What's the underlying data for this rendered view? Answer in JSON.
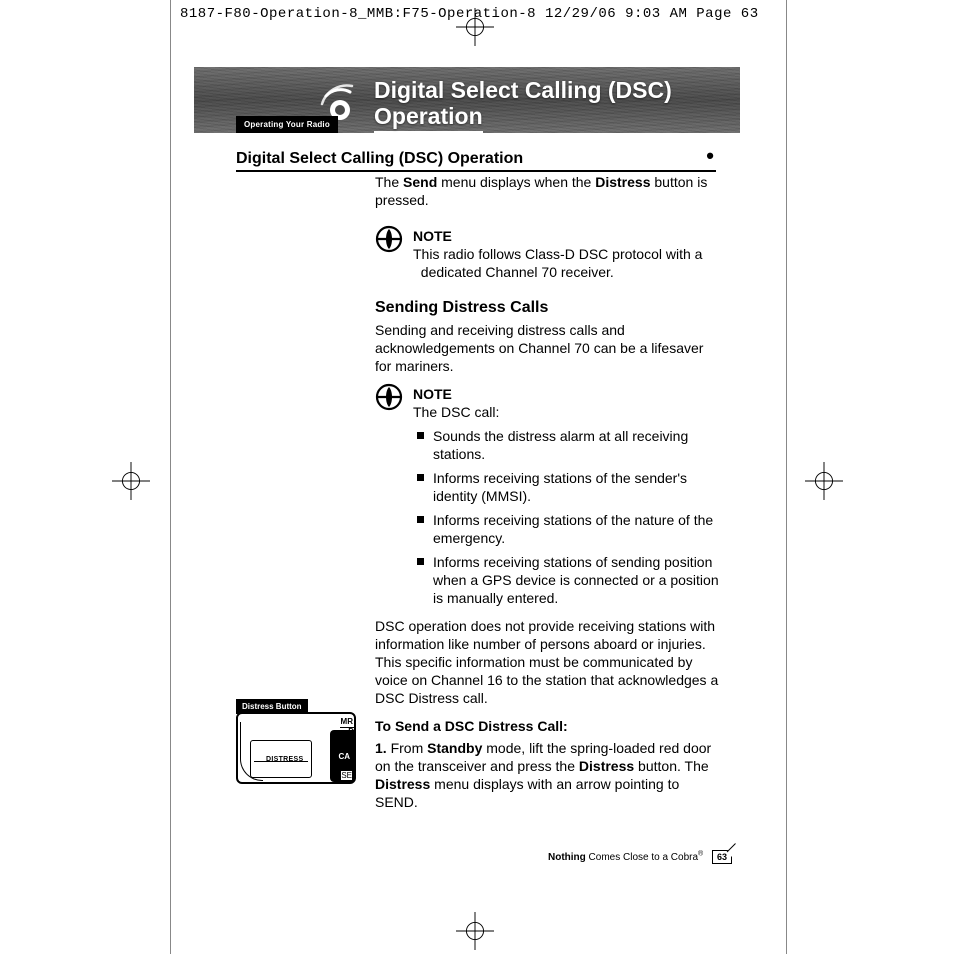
{
  "print_header": "8187-F80-Operation-8_MMB:F75-Operation-8  12/29/06  9:03 AM  Page 63",
  "banner": {
    "title_line1": "Digital Select Calling (DSC)",
    "title_line2": "Operation",
    "tab": "Operating Your Radio"
  },
  "section_heading": "Digital Select Calling (DSC) Operation",
  "intro": {
    "pre": "The ",
    "bold1": "Send",
    "mid": " menu displays when the ",
    "bold2": "Distress",
    "post": " button is pressed."
  },
  "note1": {
    "label": "NOTE",
    "line1": "This radio follows Class-D DSC protocol with a",
    "line2": "dedicated Channel 70 receiver."
  },
  "sub1": "Sending Distress Calls",
  "sub1_body": "Sending and receiving distress calls and acknowledgements on Channel 70 can be a lifesaver for mariners.",
  "note2": {
    "label": "NOTE",
    "intro": "The DSC call:"
  },
  "bullets": [
    "Sounds the distress alarm at all receiving stations.",
    "Informs receiving stations of the sender's identity (MMSI).",
    "Informs receiving stations of the nature of the emergency.",
    "Informs receiving stations of sending position when a GPS device is connected or a position is manually entered."
  ],
  "dsc_para": "DSC operation does not provide receiving stations with information like number of persons aboard or injuries. This specific information must be communicated by voice on Channel 16 to the station that acknowledges a DSC Distress call.",
  "tosend": "To Send a DSC Distress Call:",
  "step1": {
    "num": "1.",
    "a": "From ",
    "b_bold": "Standby",
    "c": " mode, lift the spring-loaded red door on the transceiver and press the ",
    "d_bold": "Distress",
    "e": " button. The ",
    "f_bold": "Distress",
    "g": " menu displays with an arrow pointing to SEND."
  },
  "figure": {
    "caption": "Distress Button",
    "label": "DISTRESS",
    "mr": "MR",
    "d": "D",
    "se": "SE",
    "ca": "CA"
  },
  "footer": {
    "bold": "Nothing",
    "rest": " Comes Close to a Cobra",
    "page": "63"
  }
}
